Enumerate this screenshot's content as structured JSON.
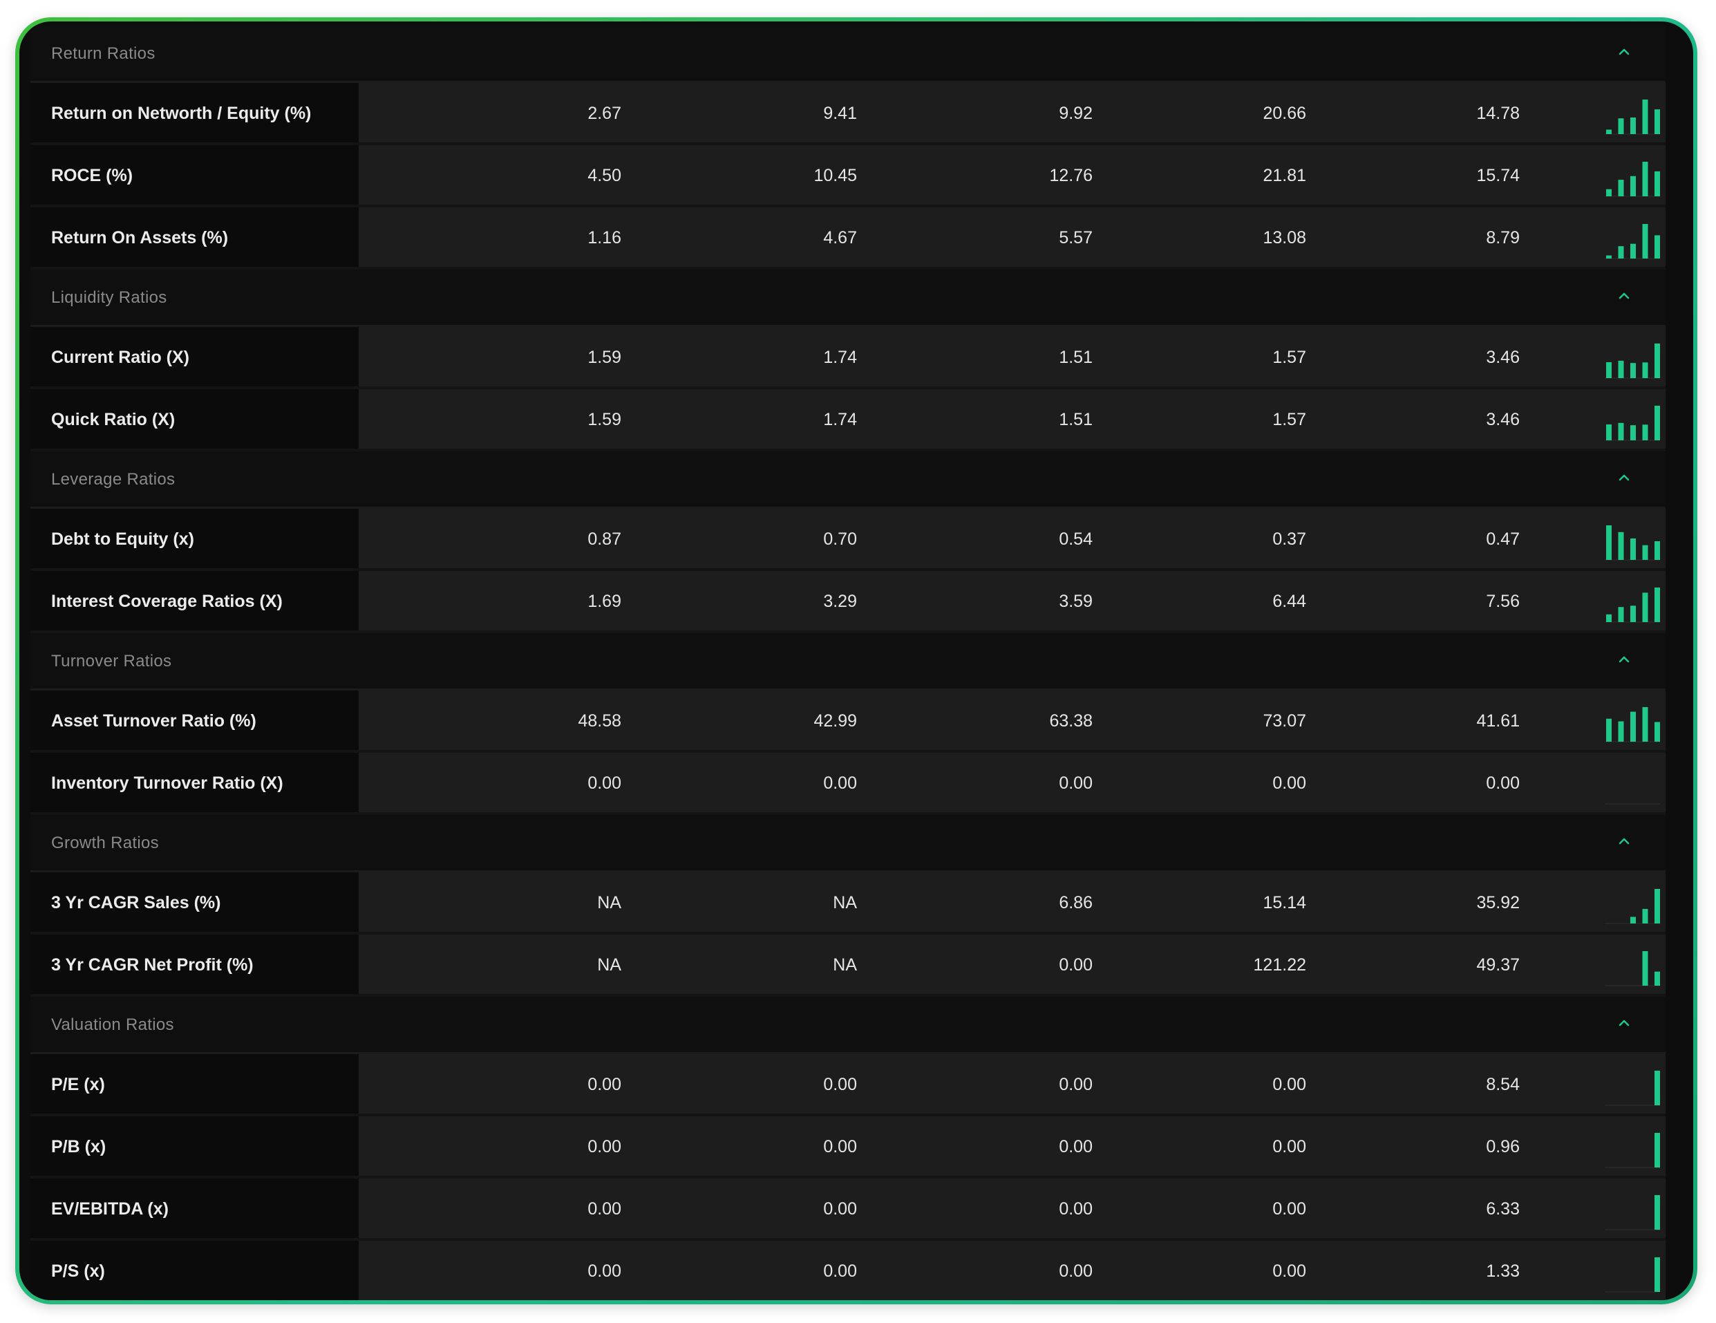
{
  "accent_color": "#1fc98a",
  "chevron_icon": "chevron-up-icon",
  "sections": [
    {
      "title": "Return Ratios",
      "rows": [
        {
          "label": "Return on Networth / Equity (%)",
          "values": [
            "2.67",
            "9.41",
            "9.92",
            "20.66",
            "14.78"
          ],
          "trend": [
            2.67,
            9.41,
            9.92,
            20.66,
            14.78
          ]
        },
        {
          "label": "ROCE (%)",
          "values": [
            "4.50",
            "10.45",
            "12.76",
            "21.81",
            "15.74"
          ],
          "trend": [
            4.5,
            10.45,
            12.76,
            21.81,
            15.74
          ]
        },
        {
          "label": "Return On Assets (%)",
          "values": [
            "1.16",
            "4.67",
            "5.57",
            "13.08",
            "8.79"
          ],
          "trend": [
            1.16,
            4.67,
            5.57,
            13.08,
            8.79
          ]
        }
      ]
    },
    {
      "title": "Liquidity Ratios",
      "rows": [
        {
          "label": "Current Ratio (X)",
          "values": [
            "1.59",
            "1.74",
            "1.51",
            "1.57",
            "3.46"
          ],
          "trend": [
            1.59,
            1.74,
            1.51,
            1.57,
            3.46
          ]
        },
        {
          "label": "Quick Ratio (X)",
          "values": [
            "1.59",
            "1.74",
            "1.51",
            "1.57",
            "3.46"
          ],
          "trend": [
            1.59,
            1.74,
            1.51,
            1.57,
            3.46
          ]
        }
      ]
    },
    {
      "title": "Leverage Ratios",
      "rows": [
        {
          "label": "Debt to Equity (x)",
          "values": [
            "0.87",
            "0.70",
            "0.54",
            "0.37",
            "0.47"
          ],
          "trend": [
            0.87,
            0.7,
            0.54,
            0.37,
            0.47
          ]
        },
        {
          "label": "Interest Coverage Ratios (X)",
          "values": [
            "1.69",
            "3.29",
            "3.59",
            "6.44",
            "7.56"
          ],
          "trend": [
            1.69,
            3.29,
            3.59,
            6.44,
            7.56
          ]
        }
      ]
    },
    {
      "title": "Turnover Ratios",
      "rows": [
        {
          "label": "Asset Turnover Ratio (%)",
          "values": [
            "48.58",
            "42.99",
            "63.38",
            "73.07",
            "41.61"
          ],
          "trend": [
            48.58,
            42.99,
            63.38,
            73.07,
            41.61
          ]
        },
        {
          "label": "Inventory Turnover Ratio (X)",
          "values": [
            "0.00",
            "0.00",
            "0.00",
            "0.00",
            "0.00"
          ],
          "trend": [
            0,
            0,
            0,
            0,
            0
          ]
        }
      ]
    },
    {
      "title": "Growth Ratios",
      "rows": [
        {
          "label": "3 Yr CAGR Sales (%)",
          "values": [
            "NA",
            "NA",
            "6.86",
            "15.14",
            "35.92"
          ],
          "trend": [
            0,
            0,
            6.86,
            15.14,
            35.92
          ]
        },
        {
          "label": "3 Yr CAGR Net Profit (%)",
          "values": [
            "NA",
            "NA",
            "0.00",
            "121.22",
            "49.37"
          ],
          "trend": [
            0,
            0,
            0,
            121.22,
            49.37
          ]
        }
      ]
    },
    {
      "title": "Valuation Ratios",
      "rows": [
        {
          "label": "P/E (x)",
          "values": [
            "0.00",
            "0.00",
            "0.00",
            "0.00",
            "8.54"
          ],
          "trend": [
            0,
            0,
            0,
            0,
            8.54
          ]
        },
        {
          "label": "P/B (x)",
          "values": [
            "0.00",
            "0.00",
            "0.00",
            "0.00",
            "0.96"
          ],
          "trend": [
            0,
            0,
            0,
            0,
            0.96
          ]
        },
        {
          "label": "EV/EBITDA (x)",
          "values": [
            "0.00",
            "0.00",
            "0.00",
            "0.00",
            "6.33"
          ],
          "trend": [
            0,
            0,
            0,
            0,
            6.33
          ]
        },
        {
          "label": "P/S (x)",
          "values": [
            "0.00",
            "0.00",
            "0.00",
            "0.00",
            "1.33"
          ],
          "trend": [
            0,
            0,
            0,
            0,
            1.33
          ]
        }
      ]
    }
  ]
}
